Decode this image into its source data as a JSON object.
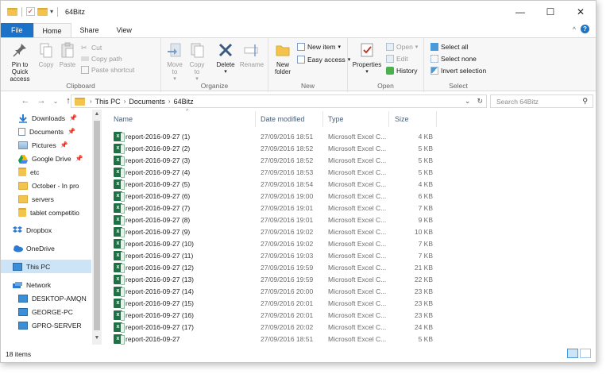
{
  "window": {
    "title": "64Bitz",
    "controls": {
      "minimize": "—",
      "maximize": "☐",
      "close": "✕"
    }
  },
  "tabs": [
    "File",
    "Home",
    "Share",
    "View"
  ],
  "ribbon": {
    "clipboard": {
      "label": "Clipboard",
      "pin": "Pin to Quick access",
      "copy": "Copy",
      "paste": "Paste",
      "cut": "Cut",
      "copy_path": "Copy path",
      "paste_shortcut": "Paste shortcut"
    },
    "organize": {
      "label": "Organize",
      "move_to": "Move to",
      "copy_to": "Copy to",
      "delete": "Delete",
      "rename": "Rename"
    },
    "new": {
      "label": "New",
      "new_folder": "New folder",
      "new_item": "New item",
      "easy_access": "Easy access"
    },
    "open": {
      "label": "Open",
      "properties": "Properties",
      "open": "Open",
      "edit": "Edit",
      "history": "History"
    },
    "select": {
      "label": "Select",
      "select_all": "Select all",
      "select_none": "Select none",
      "invert": "Invert selection"
    }
  },
  "address": {
    "crumbs": [
      "This PC",
      "Documents",
      "64Bitz"
    ],
    "search_placeholder": "Search 64Bitz"
  },
  "nav": {
    "items": [
      {
        "label": "Downloads",
        "icon": "download-icon",
        "pinned": true
      },
      {
        "label": "Documents",
        "icon": "documents-icon",
        "pinned": true
      },
      {
        "label": "Pictures",
        "icon": "pictures-icon",
        "pinned": true
      },
      {
        "label": "Google Drive",
        "icon": "google-drive-icon",
        "pinned": true
      },
      {
        "label": "etc",
        "icon": "folder-icon",
        "pinned": false
      },
      {
        "label": "October - In pro",
        "icon": "folder-icon",
        "pinned": false
      },
      {
        "label": "servers",
        "icon": "folder-icon",
        "pinned": false
      },
      {
        "label": "tablet competitio",
        "icon": "folder-icon",
        "pinned": false
      },
      {
        "label": "Dropbox",
        "icon": "dropbox-icon",
        "pinned": false
      },
      {
        "label": "OneDrive",
        "icon": "onedrive-icon",
        "pinned": false
      },
      {
        "label": "This PC",
        "icon": "this-pc-icon",
        "pinned": false
      },
      {
        "label": "Network",
        "icon": "network-icon",
        "pinned": false
      },
      {
        "label": "DESKTOP-AMQN",
        "icon": "computer-icon",
        "pinned": false
      },
      {
        "label": "GEORGE-PC",
        "icon": "computer-icon",
        "pinned": false
      },
      {
        "label": "GPRO-SERVER",
        "icon": "computer-icon",
        "pinned": false
      }
    ]
  },
  "columns": {
    "name": "Name",
    "date": "Date modified",
    "type": "Type",
    "size": "Size"
  },
  "files": [
    {
      "name": "report-2016-09-27 (1)",
      "date": "27/09/2016 18:51",
      "type": "Microsoft Excel C...",
      "size": "4 KB"
    },
    {
      "name": "report-2016-09-27 (2)",
      "date": "27/09/2016 18:52",
      "type": "Microsoft Excel C...",
      "size": "5 KB"
    },
    {
      "name": "report-2016-09-27 (3)",
      "date": "27/09/2016 18:52",
      "type": "Microsoft Excel C...",
      "size": "5 KB"
    },
    {
      "name": "report-2016-09-27 (4)",
      "date": "27/09/2016 18:53",
      "type": "Microsoft Excel C...",
      "size": "5 KB"
    },
    {
      "name": "report-2016-09-27 (5)",
      "date": "27/09/2016 18:54",
      "type": "Microsoft Excel C...",
      "size": "4 KB"
    },
    {
      "name": "report-2016-09-27 (6)",
      "date": "27/09/2016 19:00",
      "type": "Microsoft Excel C...",
      "size": "6 KB"
    },
    {
      "name": "report-2016-09-27 (7)",
      "date": "27/09/2016 19:01",
      "type": "Microsoft Excel C...",
      "size": "7 KB"
    },
    {
      "name": "report-2016-09-27 (8)",
      "date": "27/09/2016 19:01",
      "type": "Microsoft Excel C...",
      "size": "9 KB"
    },
    {
      "name": "report-2016-09-27 (9)",
      "date": "27/09/2016 19:02",
      "type": "Microsoft Excel C...",
      "size": "10 KB"
    },
    {
      "name": "report-2016-09-27 (10)",
      "date": "27/09/2016 19:02",
      "type": "Microsoft Excel C...",
      "size": "7 KB"
    },
    {
      "name": "report-2016-09-27 (11)",
      "date": "27/09/2016 19:03",
      "type": "Microsoft Excel C...",
      "size": "7 KB"
    },
    {
      "name": "report-2016-09-27 (12)",
      "date": "27/09/2016 19:59",
      "type": "Microsoft Excel C...",
      "size": "21 KB"
    },
    {
      "name": "report-2016-09-27 (13)",
      "date": "27/09/2016 19:59",
      "type": "Microsoft Excel C...",
      "size": "22 KB"
    },
    {
      "name": "report-2016-09-27 (14)",
      "date": "27/09/2016 20:00",
      "type": "Microsoft Excel C...",
      "size": "23 KB"
    },
    {
      "name": "report-2016-09-27 (15)",
      "date": "27/09/2016 20:01",
      "type": "Microsoft Excel C...",
      "size": "23 KB"
    },
    {
      "name": "report-2016-09-27 (16)",
      "date": "27/09/2016 20:01",
      "type": "Microsoft Excel C...",
      "size": "23 KB"
    },
    {
      "name": "report-2016-09-27 (17)",
      "date": "27/09/2016 20:02",
      "type": "Microsoft Excel C...",
      "size": "24 KB"
    },
    {
      "name": "report-2016-09-27",
      "date": "27/09/2016 18:51",
      "type": "Microsoft Excel C...",
      "size": "5 KB"
    }
  ],
  "status": {
    "count": "18 items"
  },
  "colors": {
    "accent": "#1a73c8",
    "selected": "#cce4f7",
    "excel": "#1e7145",
    "folder": "#f2c44e"
  }
}
